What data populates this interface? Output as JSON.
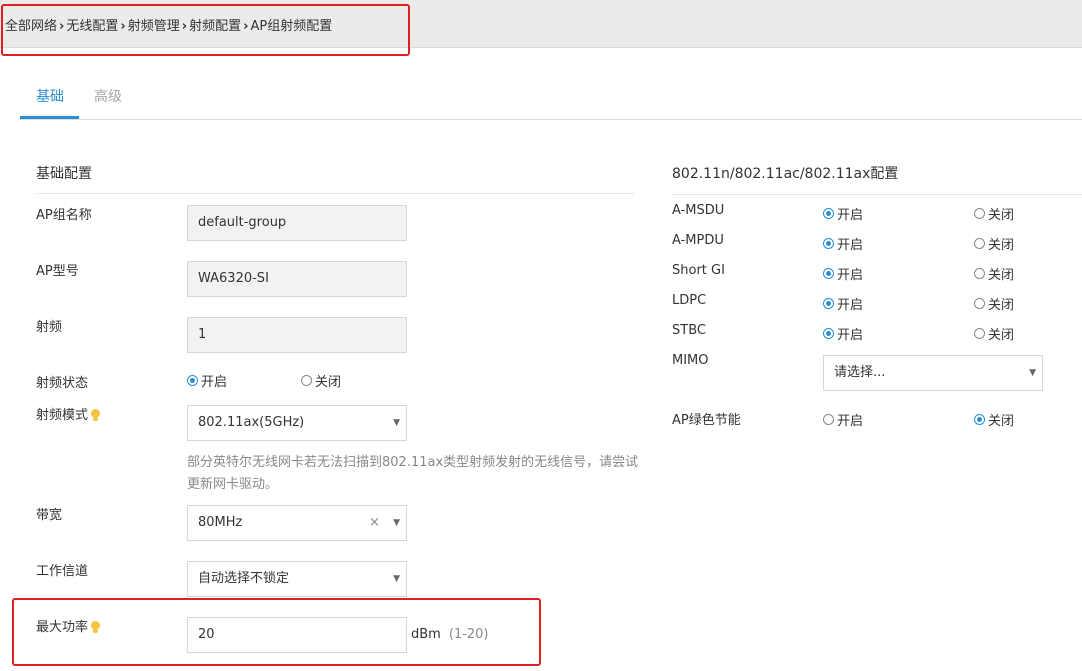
{
  "breadcrumb": [
    "全部网络",
    "无线配置",
    "射频管理",
    "射频配置",
    "AP组射频配置"
  ],
  "tabs": [
    {
      "label": "基础"
    },
    {
      "label": "高级"
    }
  ],
  "basic": {
    "title": "基础配置",
    "ap_group_name": {
      "label": "AP组名称",
      "value": "default-group"
    },
    "ap_model": {
      "label": "AP型号",
      "value": "WA6320-SI"
    },
    "radio": {
      "label": "射频",
      "value": "1"
    },
    "radio_status": {
      "label": "射频状态",
      "on": "开启",
      "off": "关闭",
      "selected": "on"
    },
    "radio_mode": {
      "label": "射频模式",
      "value": "802.11ax(5GHz)",
      "icon": "lightbulb-icon"
    },
    "hint": "部分英特尔无线网卡若无法扫描到802.11ax类型射频发射的无线信号，请尝试更新网卡驱动。",
    "bandwidth": {
      "label": "带宽",
      "value": "80MHz"
    },
    "channel": {
      "label": "工作信道",
      "value": "自动选择不锁定"
    },
    "max_power": {
      "label": "最大功率",
      "value": "20",
      "unit": "dBm",
      "range": "(1-20)",
      "icon": "lightbulb-icon"
    }
  },
  "advanced": {
    "title": "802.11n/802.11ac/802.11ax配置",
    "rows": [
      {
        "label": "A-MSDU",
        "on": "开启",
        "off": "关闭",
        "selected": "on"
      },
      {
        "label": "A-MPDU",
        "on": "开启",
        "off": "关闭",
        "selected": "on"
      },
      {
        "label": "Short GI",
        "on": "开启",
        "off": "关闭",
        "selected": "on"
      },
      {
        "label": "LDPC",
        "on": "开启",
        "off": "关闭",
        "selected": "on"
      },
      {
        "label": "STBC",
        "on": "开启",
        "off": "关闭",
        "selected": "on"
      }
    ],
    "mimo": {
      "label": "MIMO",
      "placeholder": "请选择..."
    },
    "green": {
      "label": "AP绿色节能",
      "on": "开启",
      "off": "关闭",
      "selected": "off"
    }
  },
  "colors": {
    "accent": "#2a8cd1",
    "highlight": "#e02020"
  }
}
